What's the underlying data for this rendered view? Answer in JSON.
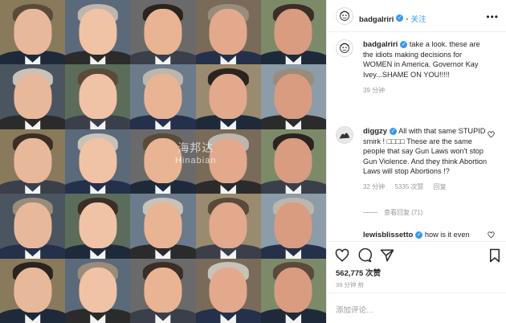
{
  "post": {
    "username": "badgalriri",
    "follow_label": "关注",
    "more_icon": "more-options-icon"
  },
  "photo": {
    "watermark_line1": "海邦达",
    "watermark_line2": "Hinabian"
  },
  "comments": [
    {
      "username": "badgalriri",
      "text": "take a look. these are the idiots making decisions for WOMEN in America. Governor Kay Ivey...SHAME ON YOU!!!!!",
      "time": "39 分钟"
    },
    {
      "username": "diggzy",
      "text": "All with that same STUPID smirk ! □□□□ These are the same people that say Gun Laws won't stop Gun Violence. And they think Abortion Laws will stop Abortions !?",
      "time": "32 分钟",
      "likes": "5335 次赞",
      "reply_label": "回复"
    },
    {
      "username": "lewisblissetto",
      "text": "how is it even"
    }
  ],
  "view_replies": "查看回复 (71)",
  "likes_count": "562,775 次赞",
  "post_time": "39 分钟 前",
  "add_comment_placeholder": "添加评论…",
  "colors": {
    "link_blue": "#3897f0",
    "muted": "#999999",
    "border": "#efefef"
  }
}
